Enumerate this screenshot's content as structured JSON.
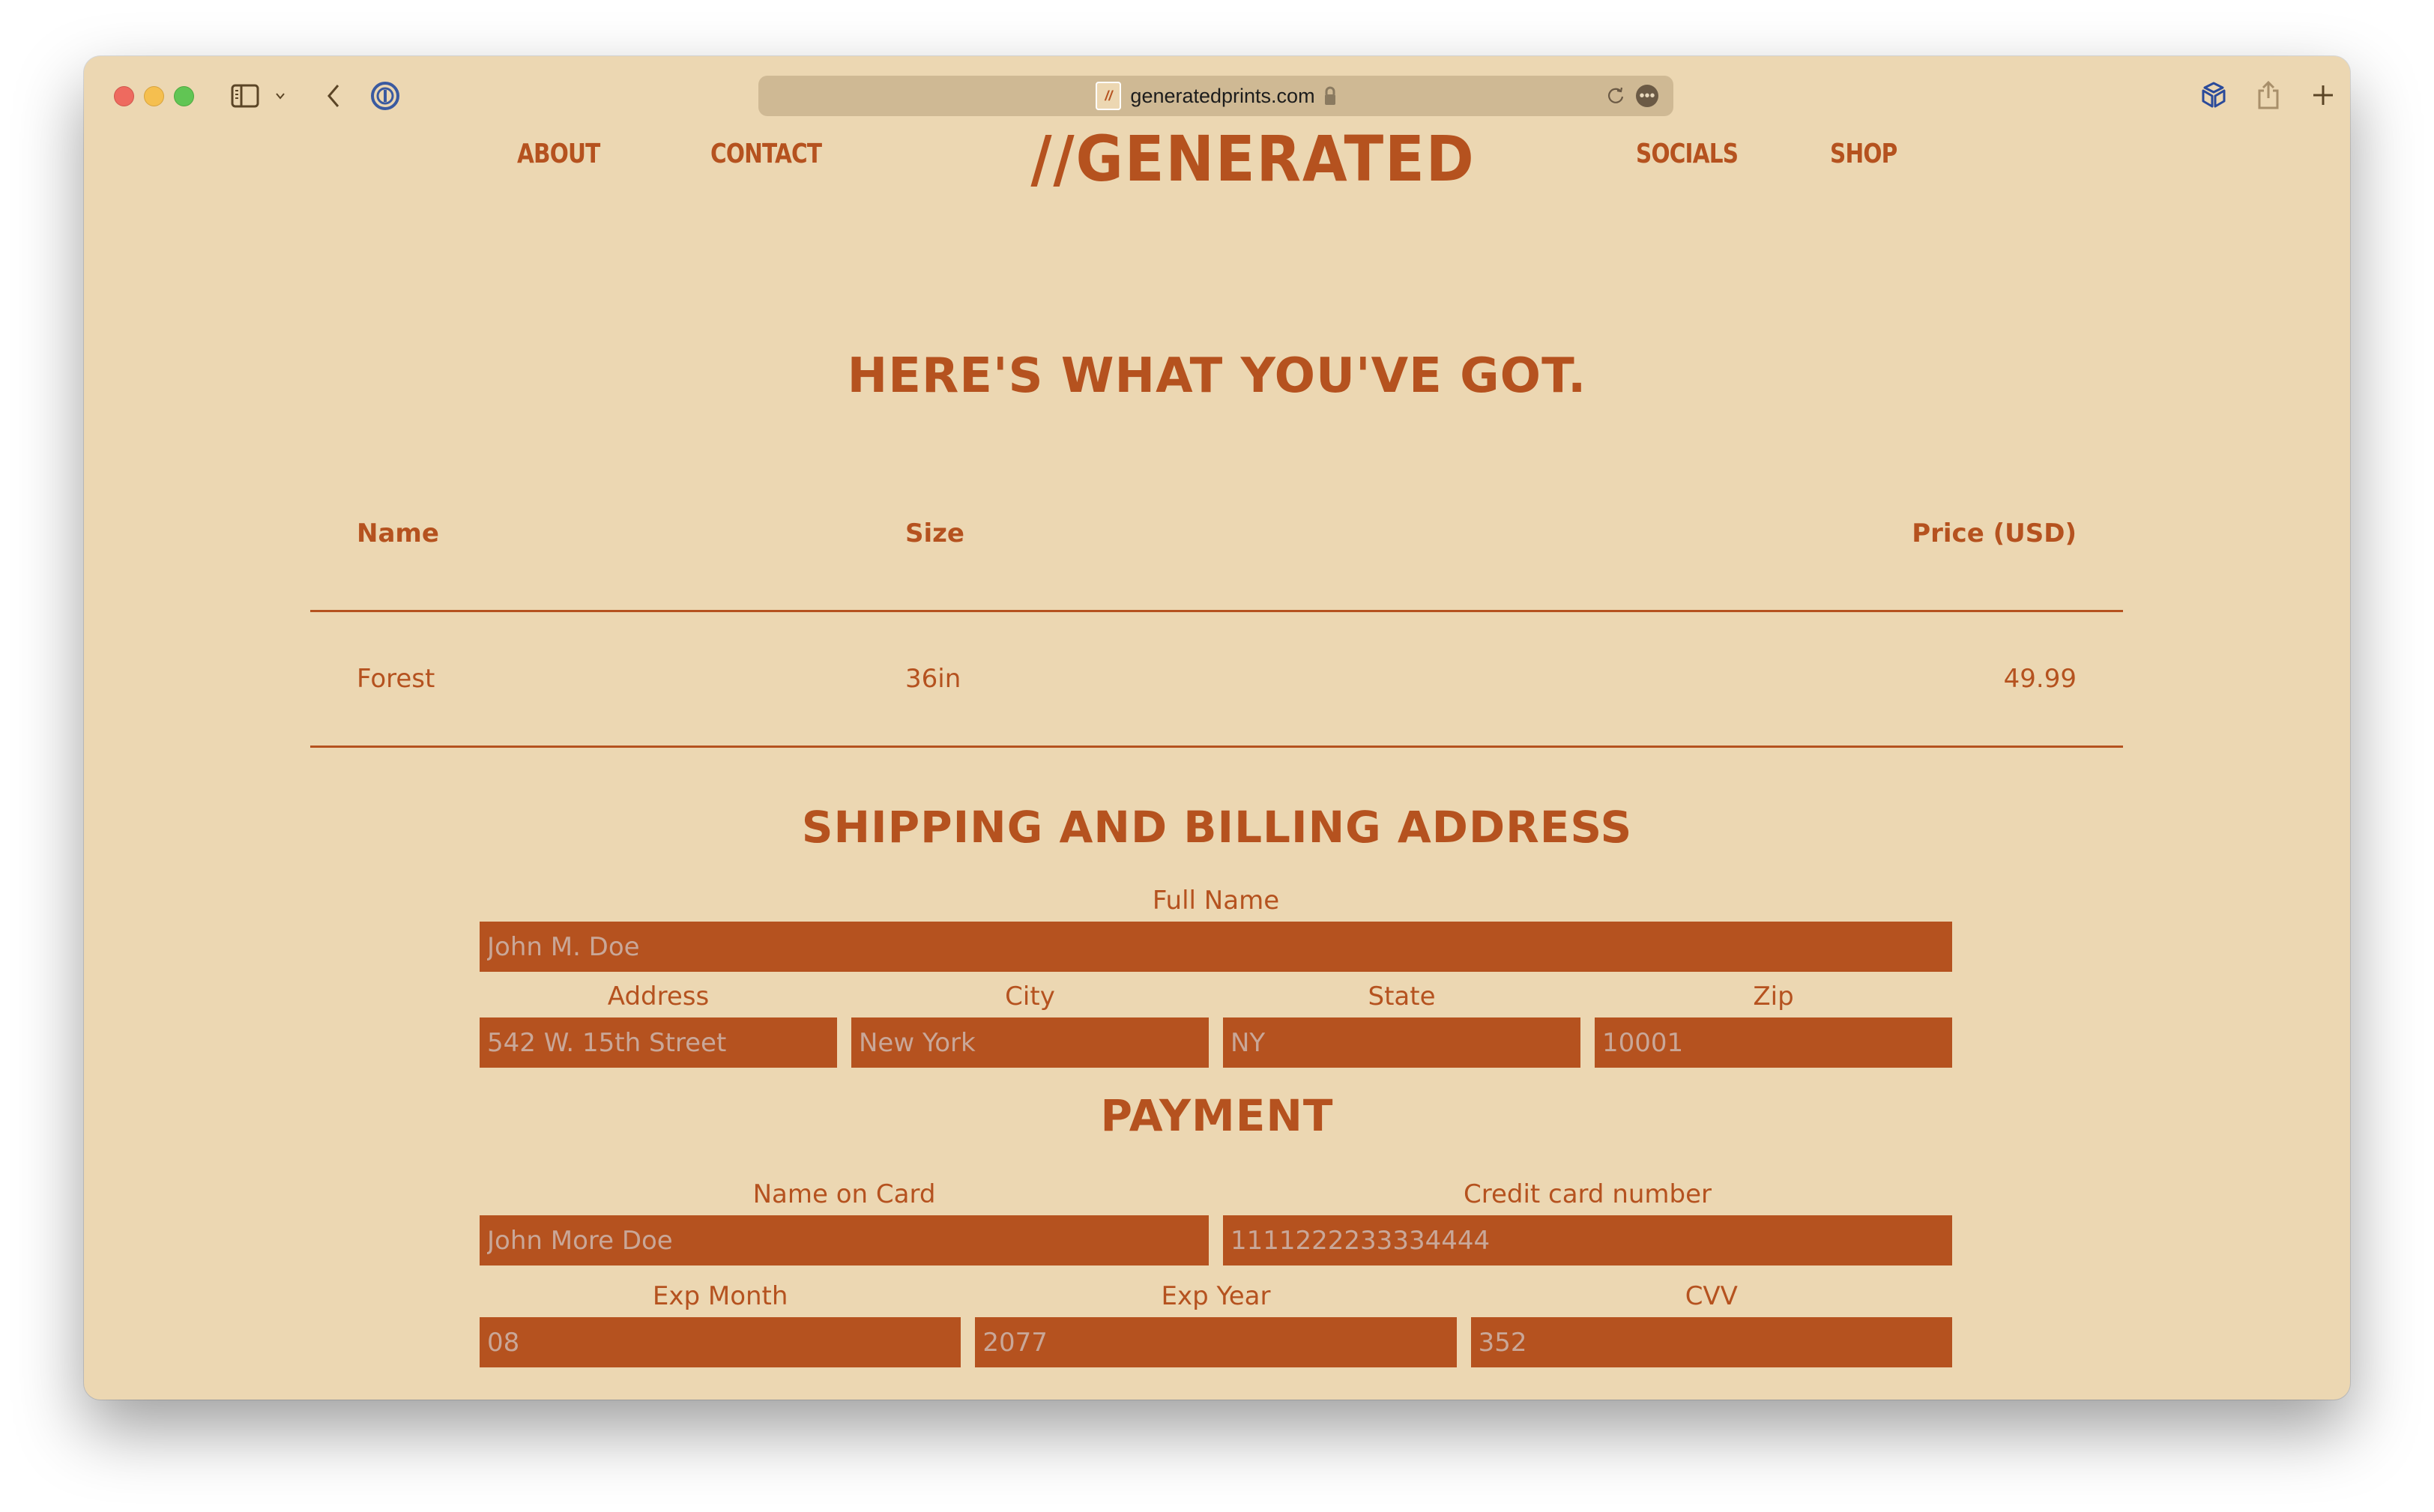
{
  "browser": {
    "url": "generatedprints.com",
    "favicon_text": "//",
    "icons": [
      "sidebar-icon",
      "chevron-down-icon",
      "back-icon",
      "password-manager-icon",
      "lock-icon",
      "reload-icon",
      "more-icon",
      "extension-cube-icon",
      "share-icon",
      "new-tab-plus-icon"
    ]
  },
  "nav": {
    "logo": "//GENERATED",
    "about": "ABOUT",
    "contact": "CONTACT",
    "socials": "SOCIALS",
    "shop": "SHOP"
  },
  "cart": {
    "heading": "HERE'S WHAT YOU'VE GOT.",
    "columns": [
      "Name",
      "Size",
      "Price (USD)"
    ],
    "rows": [
      {
        "name": "Forest",
        "size": "36in",
        "price": "49.99"
      }
    ]
  },
  "shipping": {
    "heading": "SHIPPING AND BILLING ADDRESS",
    "full_name": {
      "label": "Full Name",
      "placeholder": "John M. Doe"
    },
    "address": {
      "label": "Address",
      "placeholder": "542 W. 15th Street"
    },
    "city": {
      "label": "City",
      "placeholder": "New York"
    },
    "state": {
      "label": "State",
      "placeholder": "NY"
    },
    "zip": {
      "label": "Zip",
      "placeholder": "10001"
    }
  },
  "payment": {
    "heading": "PAYMENT",
    "name_on_card": {
      "label": "Name on Card",
      "placeholder": "John More Doe"
    },
    "card_number": {
      "label": "Credit card number",
      "placeholder": "1111222233334444"
    },
    "exp_month": {
      "label": "Exp Month",
      "placeholder": "08"
    },
    "exp_year": {
      "label": "Exp Year",
      "placeholder": "2077"
    },
    "cvv": {
      "label": "CVV",
      "placeholder": "352"
    }
  },
  "colors": {
    "background": "#ecd7b2",
    "accent": "#b5521f",
    "input_text": "#c9a798",
    "urlbar": "#cfb994"
  }
}
